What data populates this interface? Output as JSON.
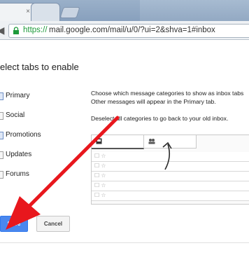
{
  "browser": {
    "tab_close_glyph": "×",
    "back_glyph": "◀",
    "url_scheme": "https://",
    "url_rest": "mail.google.com/mail/u/0/?ui=2&shva=1#inbox"
  },
  "dialog": {
    "title": "elect tabs to enable",
    "categories": [
      {
        "label": "Primary",
        "checked": true
      },
      {
        "label": "Social",
        "checked": false
      },
      {
        "label": "Promotions",
        "checked": true
      },
      {
        "label": "Updates",
        "checked": false
      },
      {
        "label": "Forums",
        "checked": false
      }
    ],
    "description_line1": "Choose which message categories to show as inbox tabs",
    "description_line2": "Other messages will appear in the Primary tab.",
    "description_line3": "Deselect all categories to go back to your old inbox.",
    "save_label": "Save",
    "cancel_label": "Cancel"
  },
  "preview": {
    "primary_tab_icon": "inbox-icon",
    "social_tab_icon": "people-icon",
    "row_glyph": "☐ ☆"
  },
  "colors": {
    "save_button": "#4a87ee",
    "annotation_arrow": "#e8171d",
    "url_scheme": "#1d9a3a"
  }
}
